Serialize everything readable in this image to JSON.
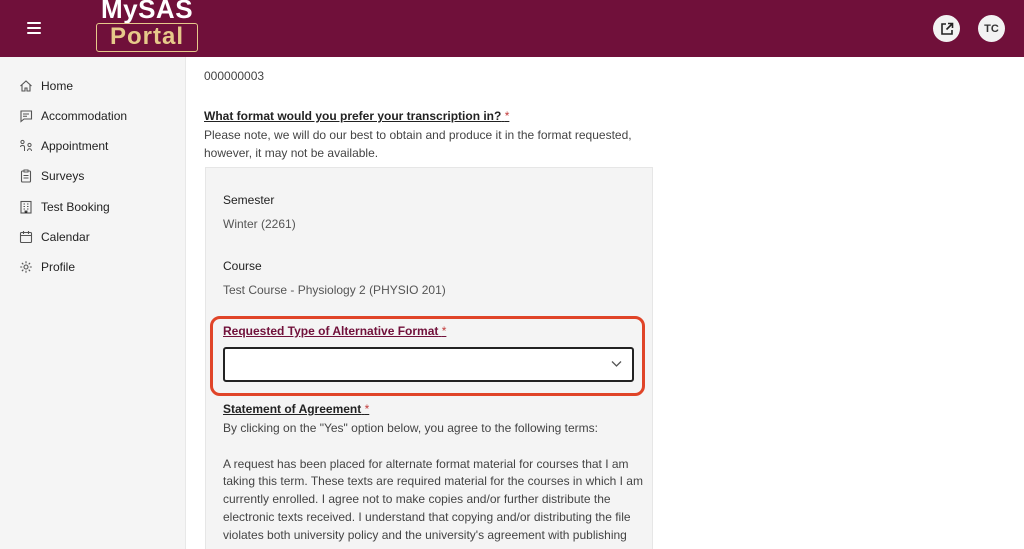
{
  "header": {
    "logo_top": "MySAS",
    "logo_bottom": "Portal",
    "avatar_initials": "TC",
    "bg_color": "#70103a"
  },
  "sidebar": {
    "items": [
      {
        "label": "Home",
        "icon": "home-icon"
      },
      {
        "label": "Accommodation",
        "icon": "chat-icon"
      },
      {
        "label": "Appointment",
        "icon": "appointment-icon"
      },
      {
        "label": "Surveys",
        "icon": "clipboard-icon"
      },
      {
        "label": "Test Booking",
        "icon": "building-icon"
      },
      {
        "label": "Calendar",
        "icon": "calendar-icon"
      },
      {
        "label": "Profile",
        "icon": "gear-icon"
      }
    ]
  },
  "main": {
    "id_value": "000000003",
    "question": "What format would you prefer your transcription in?",
    "required_mark": "*",
    "note_line1": "Please note, we will do our best to obtain and produce it in the format requested,",
    "note_line2": "however, it may not be available.",
    "semester_label": "Semester",
    "semester_value": "Winter (2261)",
    "course_label": "Course",
    "course_value": "Test Course - Physiology 2 (PHYSIO 201)",
    "format_label": "Requested Type of Alternative Format",
    "format_value": "",
    "agreement_label": "Statement of Agreement",
    "agreement_intro": "By clicking on the \"Yes\" option below, you agree to the following terms:",
    "agreement_lines": [
      "A request has been placed for alternate format material for courses that I am",
      "taking this term. These texts are required material for the courses in which I am",
      "currently enrolled. I agree not to make copies and/or further distribute the",
      "electronic texts received. I understand that copying and/or distributing the file",
      "violates both university policy and the university's agreement with publishing"
    ]
  }
}
